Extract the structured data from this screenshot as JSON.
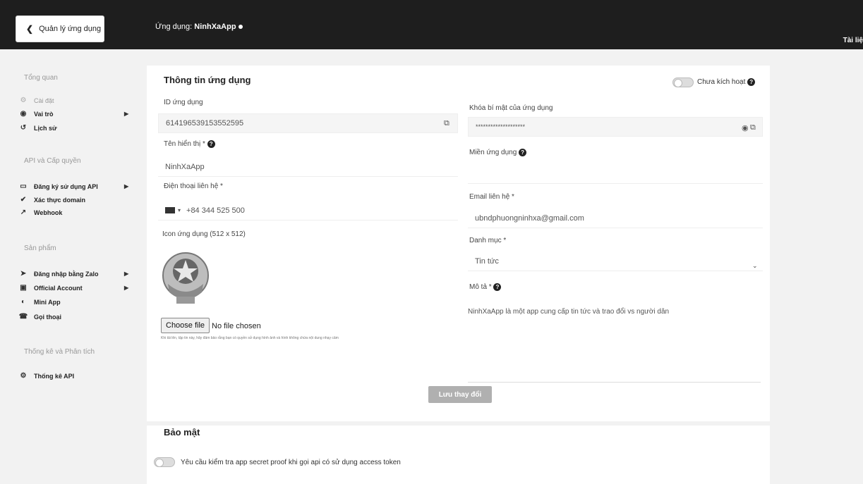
{
  "topbar": {
    "back_label": "Quản lý ứng dụng",
    "app_prefix": "Ứng dụng:",
    "app_name": "NinhXaApp",
    "docs_label": "Tài liệ"
  },
  "sidebar": {
    "sections": [
      {
        "title": "Tổng quan"
      },
      {
        "title": "API và Cấp quyền"
      },
      {
        "title": "Sản phẩm"
      },
      {
        "title": "Thống kê và Phân tích"
      }
    ],
    "items": [
      {
        "label": "Cài đặt",
        "icon": "gear-icon"
      },
      {
        "label": "Vai trò",
        "icon": "user-circle-icon"
      },
      {
        "label": "Lịch sử",
        "icon": "history-icon"
      },
      {
        "label": "Đăng ký sử dụng API",
        "icon": "monitor-icon"
      },
      {
        "label": "Xác thực domain",
        "icon": "check-circle-icon"
      },
      {
        "label": "Webhook",
        "icon": "external-link-icon"
      },
      {
        "label": "Đăng nhập bằng Zalo",
        "icon": "login-icon"
      },
      {
        "label": "Official Account",
        "icon": "oa-icon"
      },
      {
        "label": "Mini App",
        "icon": "mini-app-icon"
      },
      {
        "label": "Gọi thoại",
        "icon": "phone-icon"
      },
      {
        "label": "Thống kê API",
        "icon": "stats-icon"
      }
    ]
  },
  "app_info": {
    "title": "Thông tin ứng dụng",
    "status_label": "Chưa kích hoạt",
    "app_id_label": "ID ứng dụng",
    "app_id_value": "614196539153552595",
    "secret_label": "Khóa bí mật của ứng dụng",
    "secret_value": "********************",
    "display_name_label": "Tên hiển thị *",
    "display_name_value": "NinhXaApp",
    "domain_label": "Miền ứng dụng",
    "domain_value": "",
    "phone_label": "Điện thoại liên hệ *",
    "phone_value": "+84 344 525 500",
    "email_label": "Email liên hệ *",
    "email_value": "ubndphuongninhxa@gmail.com",
    "icon_label": "Icon ứng dụng (512 x 512)",
    "category_label": "Danh mục *",
    "category_value": "Tin tức",
    "description_label": "Mô tả *",
    "description_value": "NinhXaApp là một app cung cấp tin tức và trao đổi vs người dân",
    "choose_file_label": "Choose file",
    "no_file_label": "No file chosen",
    "upload_hint": "Khi tải lên, tập tin này, hãy đảm bảo rằng bạn có quyền sử dụng hình ảnh và hình không chứa nội dung nhạy cảm",
    "save_label": "Lưu thay đổi"
  },
  "security": {
    "title": "Bảo mật",
    "proof_label": "Yêu cầu kiểm tra app secret proof khi gọi api có sử dụng access token"
  },
  "colors": {
    "topbar": "#1e1e1e",
    "background": "#f2f2f2",
    "save_button": "#b0b0b0"
  }
}
